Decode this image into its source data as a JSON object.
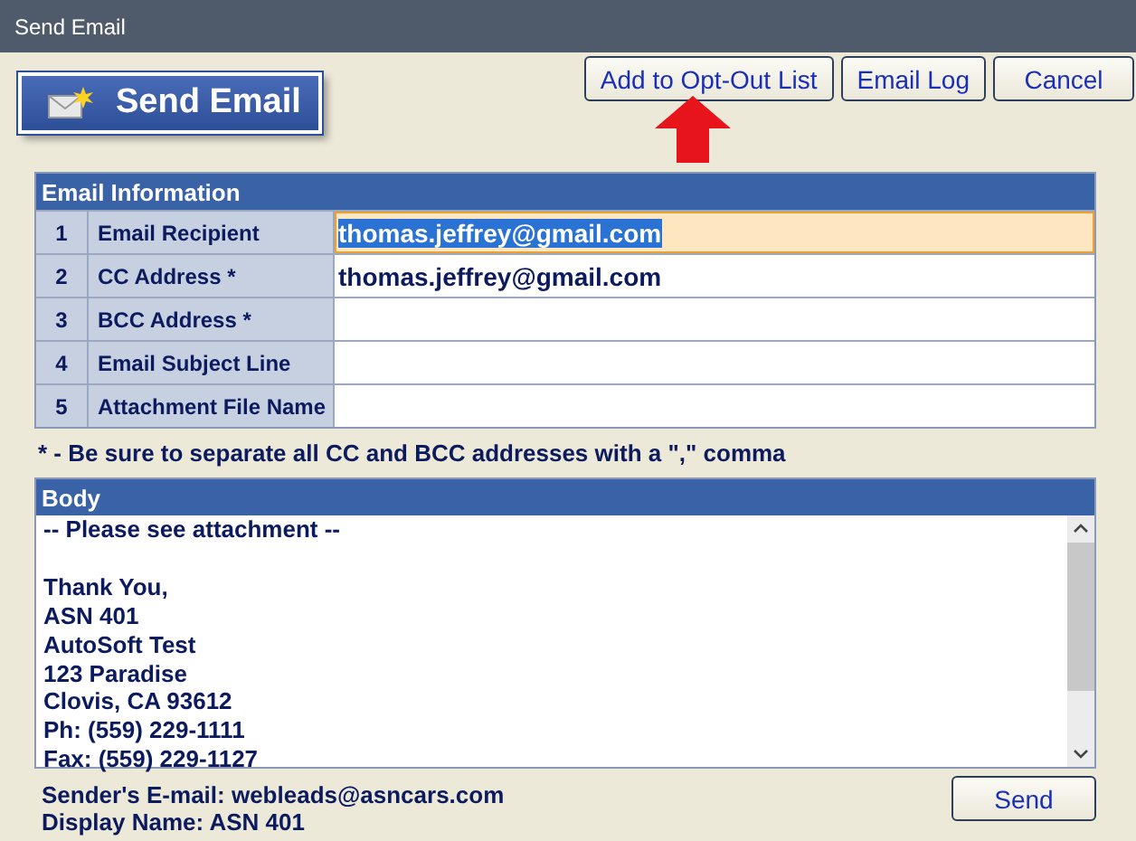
{
  "window": {
    "title": "Send Email"
  },
  "logo_button": {
    "label": "Send Email"
  },
  "toolbar": [
    "Add to Opt-Out List",
    "Email Log",
    "Cancel"
  ],
  "email_information": {
    "title": "Email Information",
    "rows": [
      {
        "number": "1",
        "label": "Email Recipient",
        "value": "thomas.jeffrey@gmail.com",
        "focused": true
      },
      {
        "number": "2",
        "label": "CC Address *",
        "value": "thomas.jeffrey@gmail.com",
        "focused": false
      },
      {
        "number": "3",
        "label": "BCC Address *",
        "focused": false
      },
      {
        "number": "4",
        "label": "Email Subject Line",
        "focused": false
      },
      {
        "number": "5",
        "label": "Attachment File Name",
        "focused": false
      }
    ]
  },
  "note": "* - Be sure to separate all CC and BCC addresses with a \",\" comma",
  "body": {
    "title": "Body",
    "paragraphs": [
      [
        "-- Please see attachment --"
      ],
      [
        "Thank You,",
        "ASN 401",
        "AutoSoft Test",
        "123 Paradise",
        "Clovis, CA 93612",
        "Ph: (559) 229-1111",
        "Fax: (559) 229-1127"
      ]
    ]
  },
  "sender_email": "Sender's E-mail: webleads@asncars.com",
  "display_name": "Display Name: ASN 401",
  "send_button": "Send"
}
